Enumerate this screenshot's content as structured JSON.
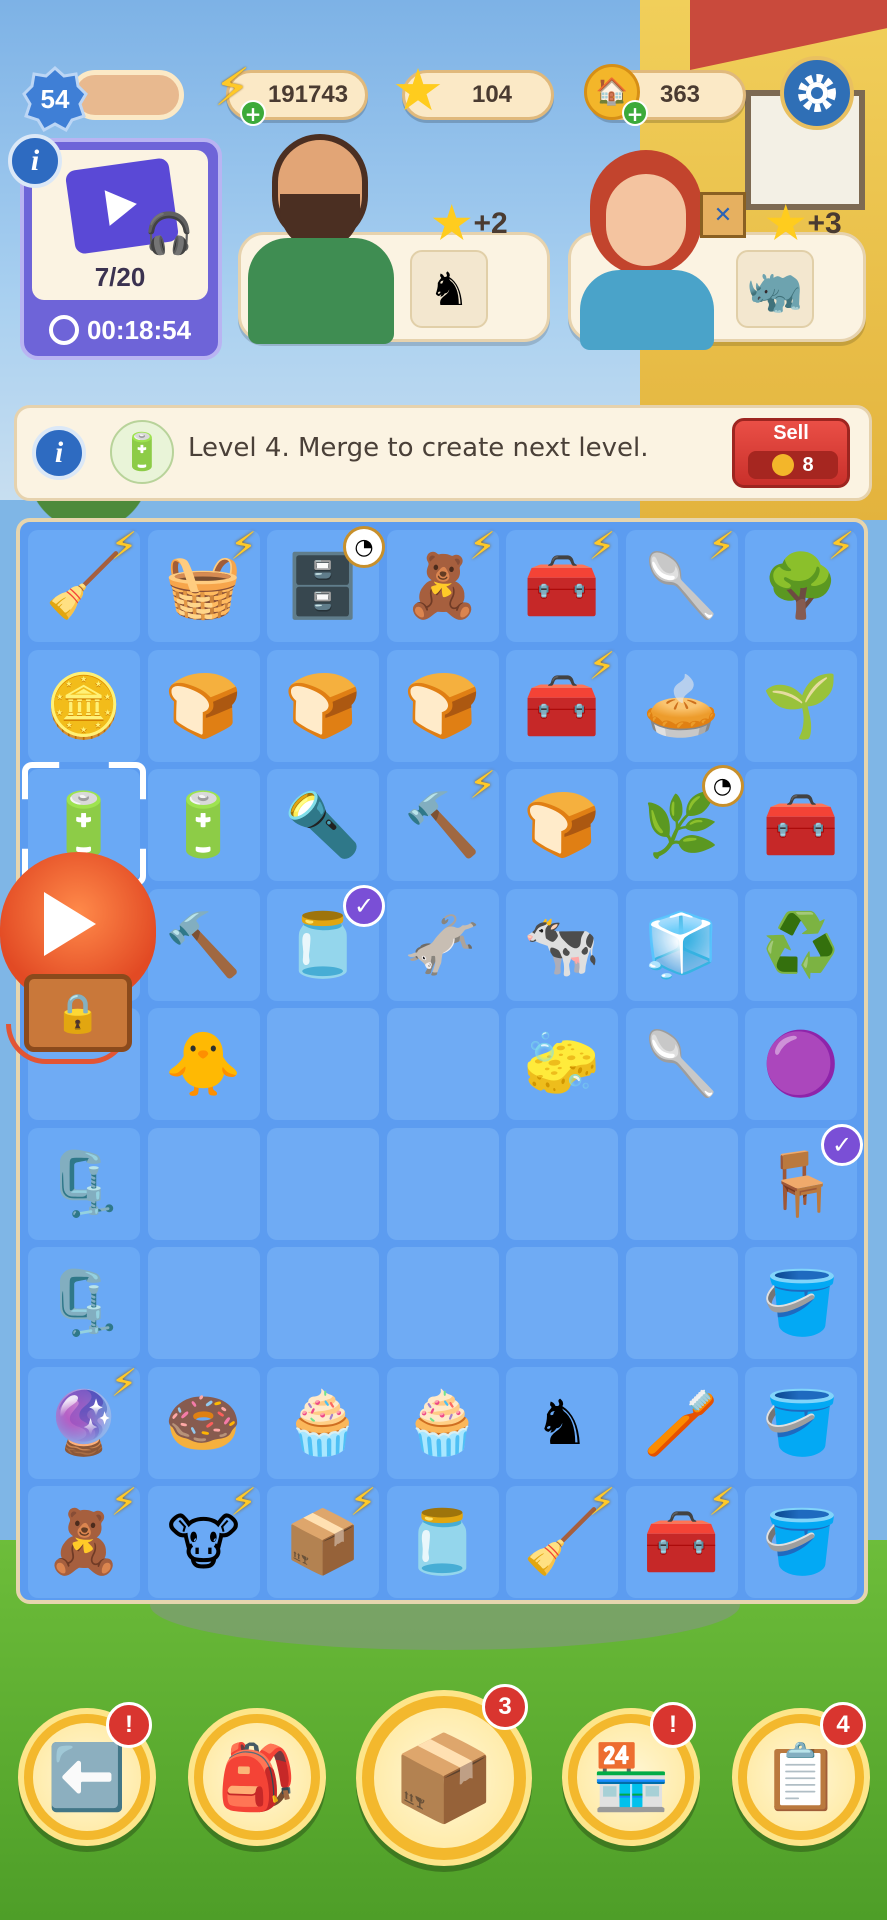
{
  "hud": {
    "player_level": "54",
    "energy": "191743",
    "stars": "104",
    "coins": "363"
  },
  "video_offer": {
    "progress": "7/20",
    "timer": "00:18:54"
  },
  "orders": [
    {
      "character": "bearded-man",
      "reward": "+2",
      "item_icon": "♞"
    },
    {
      "character": "red-haired-woman",
      "reward": "+3",
      "item_icon": "🦏"
    }
  ],
  "item_info": {
    "text": "Level 4. Merge to create next level.",
    "sell_label": "Sell",
    "sell_price": "8"
  },
  "board": {
    "rows": [
      [
        {
          "icon": "🧹",
          "badge": "energy"
        },
        {
          "icon": "🧺",
          "badge": "energy"
        },
        {
          "icon": "🗄️",
          "badge": "clock"
        },
        {
          "icon": "🧸",
          "badge": "energy"
        },
        {
          "icon": "🧰",
          "badge": "energy"
        },
        {
          "icon": "🥄",
          "badge": "energy"
        },
        {
          "icon": "🌳",
          "badge": "energy"
        }
      ],
      [
        {
          "icon": "🪙",
          "badge": ""
        },
        {
          "icon": "🍞",
          "badge": ""
        },
        {
          "icon": "🍞",
          "badge": ""
        },
        {
          "icon": "🍞",
          "badge": ""
        },
        {
          "icon": "🧰",
          "badge": "energy"
        },
        {
          "icon": "🥧",
          "badge": ""
        },
        {
          "icon": "🌱",
          "badge": ""
        }
      ],
      [
        {
          "icon": "🔋",
          "badge": "selected"
        },
        {
          "icon": "🔋",
          "badge": ""
        },
        {
          "icon": "🔦",
          "badge": ""
        },
        {
          "icon": "🔨",
          "badge": "energy"
        },
        {
          "icon": "🍞",
          "badge": ""
        },
        {
          "icon": "🌿",
          "badge": "clock"
        },
        {
          "icon": "🧰",
          "badge": ""
        }
      ],
      [
        {
          "icon": "",
          "badge": ""
        },
        {
          "icon": "🔨",
          "badge": ""
        },
        {
          "icon": "🫙",
          "badge": "check"
        },
        {
          "icon": "🫏",
          "badge": ""
        },
        {
          "icon": "🐄",
          "badge": ""
        },
        {
          "icon": "🧊",
          "badge": ""
        },
        {
          "icon": "♻️",
          "badge": ""
        }
      ],
      [
        {
          "icon": "",
          "badge": ""
        },
        {
          "icon": "🐥",
          "badge": ""
        },
        {
          "icon": "",
          "badge": ""
        },
        {
          "icon": "",
          "badge": ""
        },
        {
          "icon": "🧽",
          "badge": ""
        },
        {
          "icon": "🥄",
          "badge": ""
        },
        {
          "icon": "🟣",
          "badge": ""
        }
      ],
      [
        {
          "icon": "🗜️",
          "badge": ""
        },
        {
          "icon": "",
          "badge": ""
        },
        {
          "icon": "",
          "badge": ""
        },
        {
          "icon": "",
          "badge": ""
        },
        {
          "icon": "",
          "badge": ""
        },
        {
          "icon": "",
          "badge": ""
        },
        {
          "icon": "🪑",
          "badge": "check"
        }
      ],
      [
        {
          "icon": "🗜️",
          "badge": ""
        },
        {
          "icon": "",
          "badge": ""
        },
        {
          "icon": "",
          "badge": ""
        },
        {
          "icon": "",
          "badge": ""
        },
        {
          "icon": "",
          "badge": ""
        },
        {
          "icon": "",
          "badge": ""
        },
        {
          "icon": "🪣",
          "badge": ""
        }
      ],
      [
        {
          "icon": "🔮",
          "badge": "energy"
        },
        {
          "icon": "🍩",
          "badge": ""
        },
        {
          "icon": "🧁",
          "badge": ""
        },
        {
          "icon": "🧁",
          "badge": ""
        },
        {
          "icon": "♞",
          "badge": ""
        },
        {
          "icon": "🪥",
          "badge": ""
        },
        {
          "icon": "🪣",
          "badge": ""
        }
      ],
      [
        {
          "icon": "🧸",
          "badge": "energy"
        },
        {
          "icon": "🐮",
          "badge": "energy"
        },
        {
          "icon": "📦",
          "badge": "energy"
        },
        {
          "icon": "🫙",
          "badge": ""
        },
        {
          "icon": "🧹",
          "badge": "energy"
        },
        {
          "icon": "🧰",
          "badge": "energy"
        },
        {
          "icon": "🪣",
          "badge": ""
        }
      ]
    ]
  },
  "bottom_nav": [
    {
      "name": "back",
      "icon": "⬅️",
      "badge": "!"
    },
    {
      "name": "backpack",
      "icon": "🎒",
      "badge": ""
    },
    {
      "name": "crate",
      "icon": "📦",
      "badge": "3"
    },
    {
      "name": "shop",
      "icon": "🏪",
      "badge": "!"
    },
    {
      "name": "tasks",
      "icon": "📋",
      "badge": "4"
    }
  ],
  "colors": {
    "board": "#5c9cf0",
    "energy": "#ffc928",
    "sell": "#d63a33",
    "nav": "#f3b82d"
  }
}
